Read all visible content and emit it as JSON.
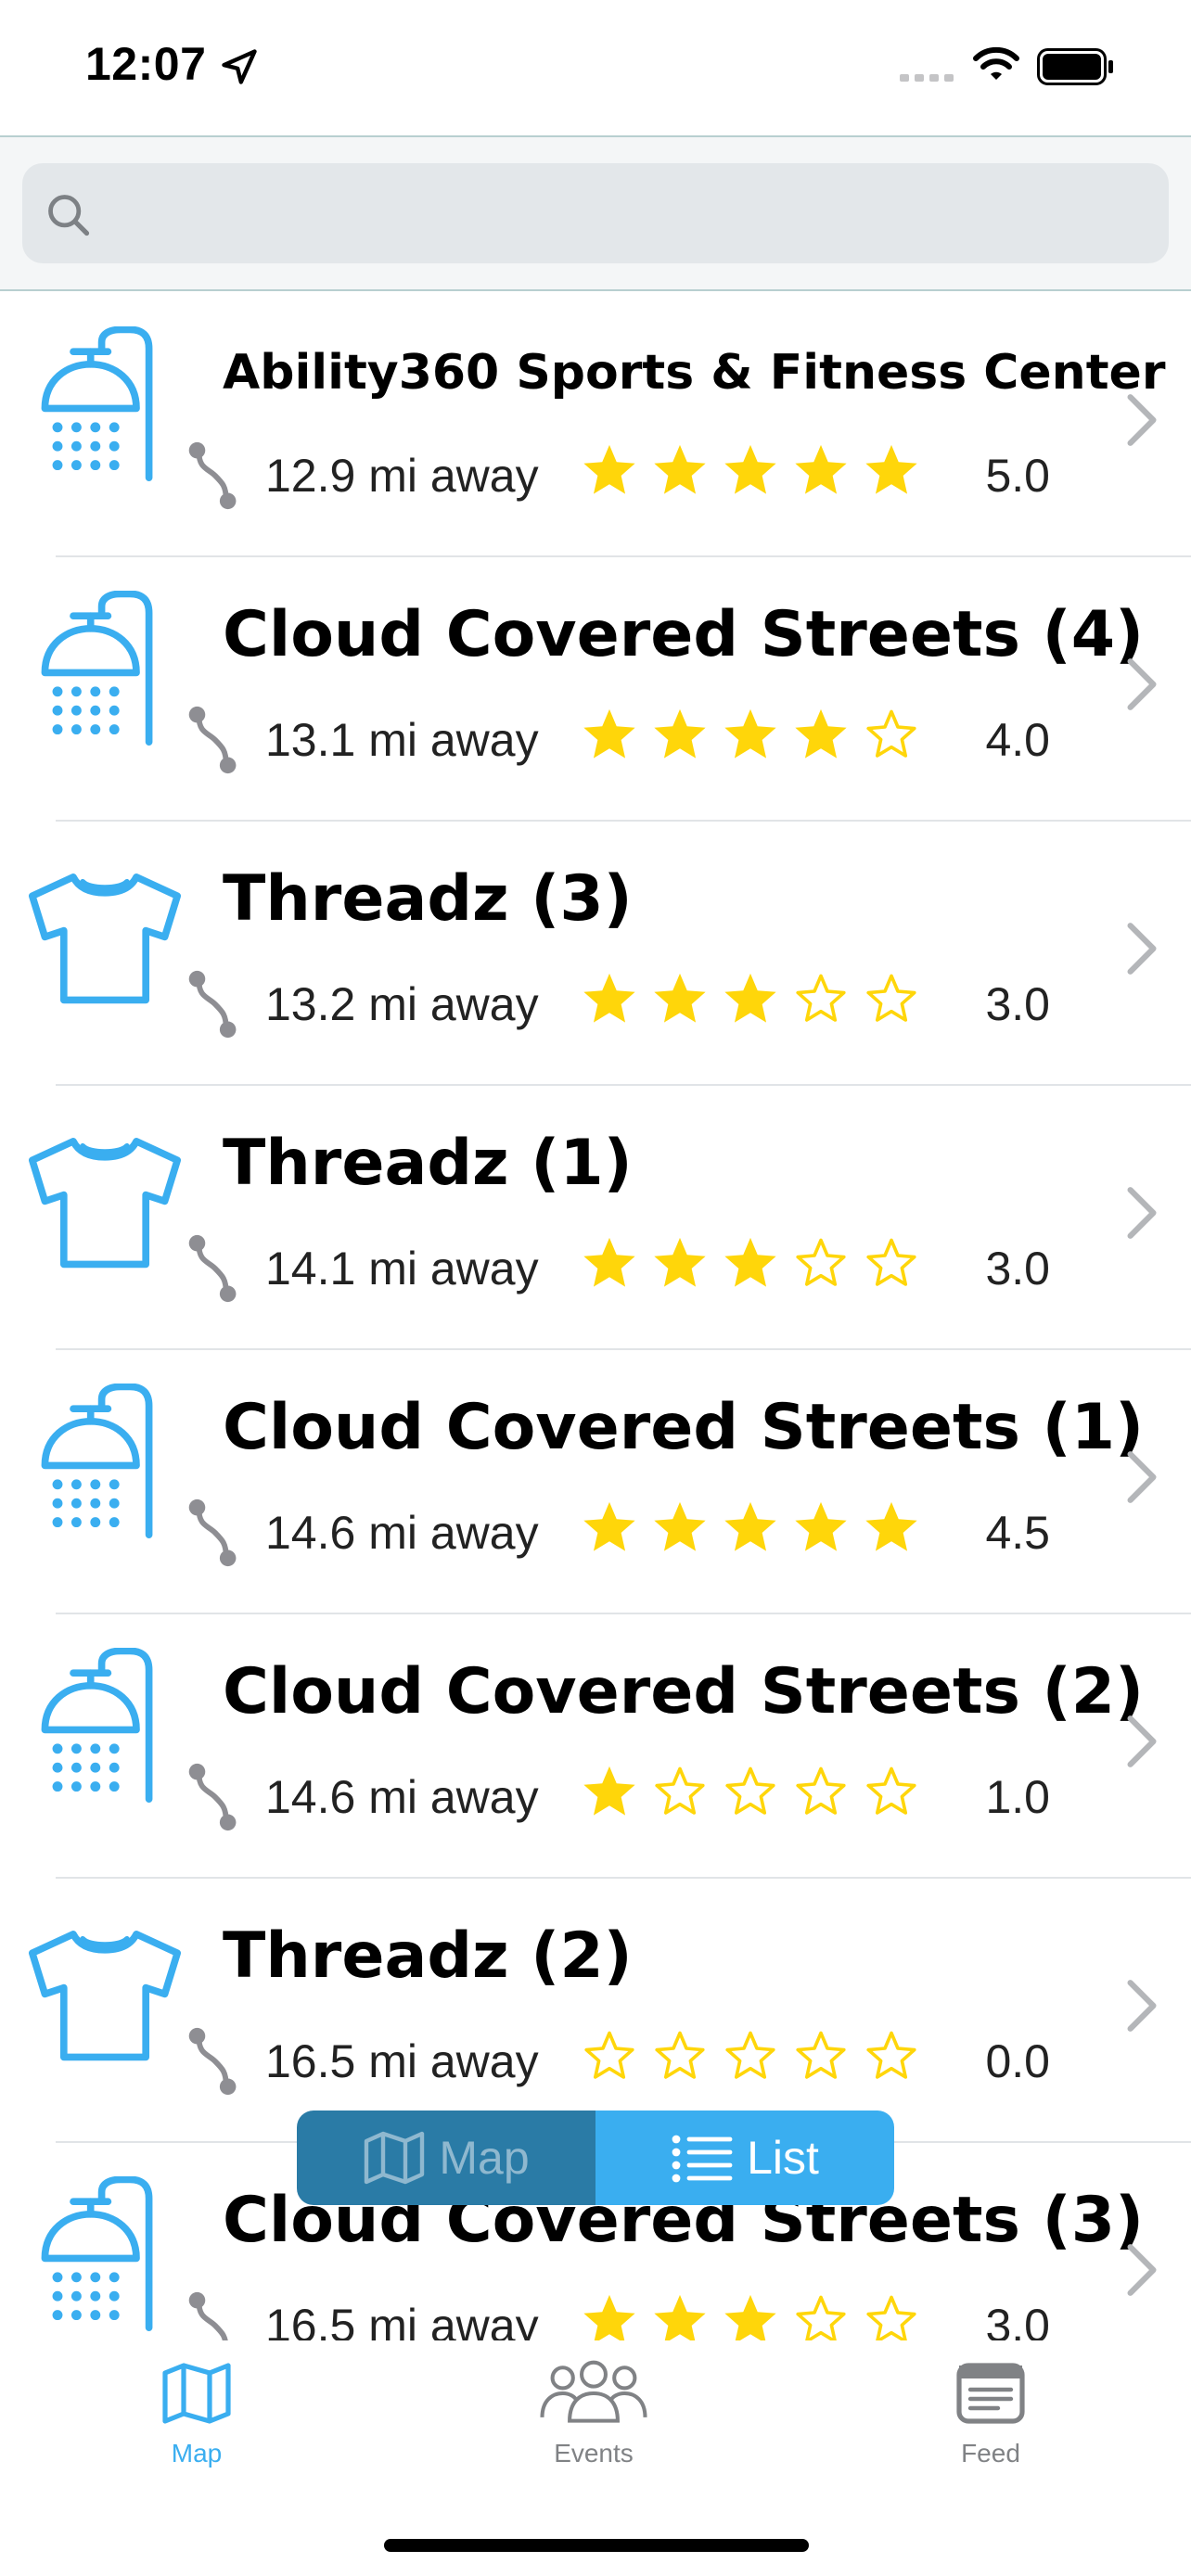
{
  "status_bar": {
    "time": "12:07"
  },
  "search": {
    "placeholder": "",
    "value": ""
  },
  "list": {
    "items": [
      {
        "category": "shower-icon",
        "name": "Ability360 Sports & Fitness Center",
        "distance": "12.9 mi away",
        "stars": 5,
        "rating": "5.0"
      },
      {
        "category": "shower-icon",
        "name": "Cloud Covered Streets (4)",
        "distance": "13.1 mi away",
        "stars": 4,
        "rating": "4.0"
      },
      {
        "category": "tshirt-icon",
        "name": "Threadz (3)",
        "distance": "13.2 mi away",
        "stars": 3,
        "rating": "3.0"
      },
      {
        "category": "tshirt-icon",
        "name": "Threadz (1)",
        "distance": "14.1 mi away",
        "stars": 3,
        "rating": "3.0"
      },
      {
        "category": "shower-icon",
        "name": "Cloud Covered Streets (1)",
        "distance": "14.6 mi away",
        "stars": 5,
        "rating": "4.5"
      },
      {
        "category": "shower-icon",
        "name": "Cloud Covered Streets (2)",
        "distance": "14.6 mi away",
        "stars": 1,
        "rating": "1.0"
      },
      {
        "category": "tshirt-icon",
        "name": "Threadz (2)",
        "distance": "16.5 mi away",
        "stars": 0,
        "rating": "0.0"
      },
      {
        "category": "shower-icon",
        "name": "Cloud Covered Streets (3)",
        "distance": "16.5 mi away",
        "stars": 3,
        "rating": "3.0"
      }
    ]
  },
  "toggle": {
    "map_label": "Map",
    "list_label": "List",
    "selected": "List"
  },
  "tab_bar": {
    "tabs": [
      {
        "label": "Map",
        "icon": "map-icon",
        "active": true
      },
      {
        "label": "Events",
        "icon": "people-icon",
        "active": false
      },
      {
        "label": "Feed",
        "icon": "news-icon",
        "active": false
      }
    ]
  },
  "colors": {
    "accent": "#3aaef0",
    "star": "#ffd60a",
    "toggle_inactive": "#2a7ba6",
    "divider": "#e1e4e7"
  }
}
